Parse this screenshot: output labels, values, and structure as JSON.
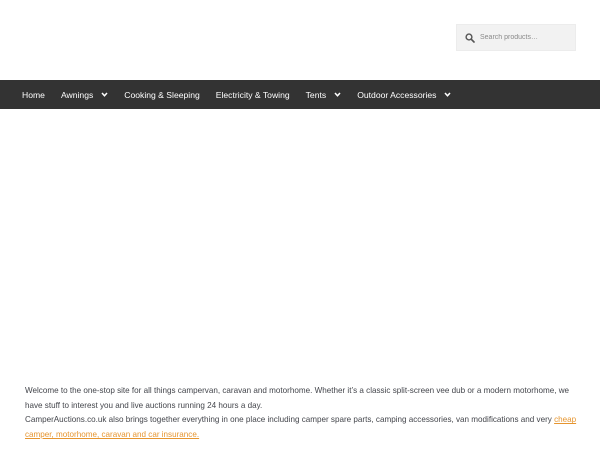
{
  "search": {
    "placeholder": "Search products…"
  },
  "nav": {
    "items": [
      {
        "label": "Home",
        "has_dropdown": false
      },
      {
        "label": "Awnings",
        "has_dropdown": true
      },
      {
        "label": "Cooking & Sleeping",
        "has_dropdown": false
      },
      {
        "label": "Electricity & Towing",
        "has_dropdown": false
      },
      {
        "label": "Tents",
        "has_dropdown": true
      },
      {
        "label": "Outdoor Accessories",
        "has_dropdown": true
      }
    ]
  },
  "intro": {
    "line1": "Welcome to the one-stop site for all things campervan, caravan and motorhome. Whether it’s a classic split-screen vee dub or a modern motorhome, we have stuff to interest you and live auctions running 24 hours a day.",
    "line2_before": "CamperAuctions.co.uk also brings together everything in one place including camper spare parts, camping accessories, van modifications and very ",
    "line2_link": "cheap camper, motorhome, caravan and car insurance."
  },
  "colors": {
    "nav_bg": "#333333",
    "link": "#e6952f",
    "text": "#43454b"
  }
}
